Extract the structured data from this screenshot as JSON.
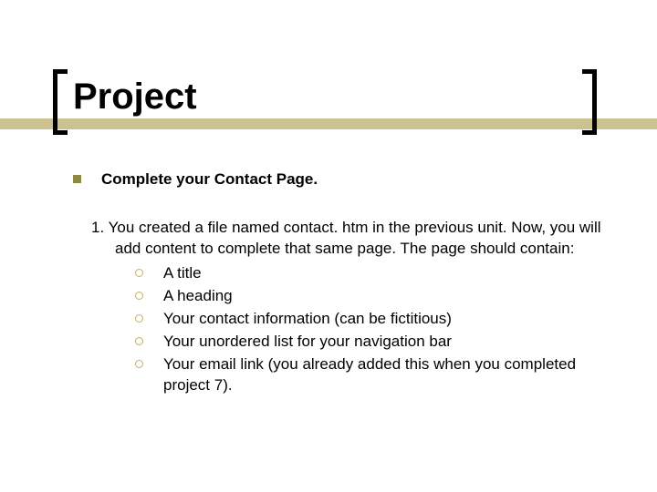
{
  "title": "Project",
  "bullet_main": "Complete your Contact Page.",
  "numbered": {
    "prefix": "1.",
    "text": "You created a file named contact. htm in the previous unit.  Now, you will add content to complete that same page. The page should contain:"
  },
  "sub_items": [
    "A title",
    "A heading",
    "Your contact information (can be fictitious)",
    "Your unordered list for your navigation bar",
    "Your email link (you already added this when you completed project 7)."
  ]
}
